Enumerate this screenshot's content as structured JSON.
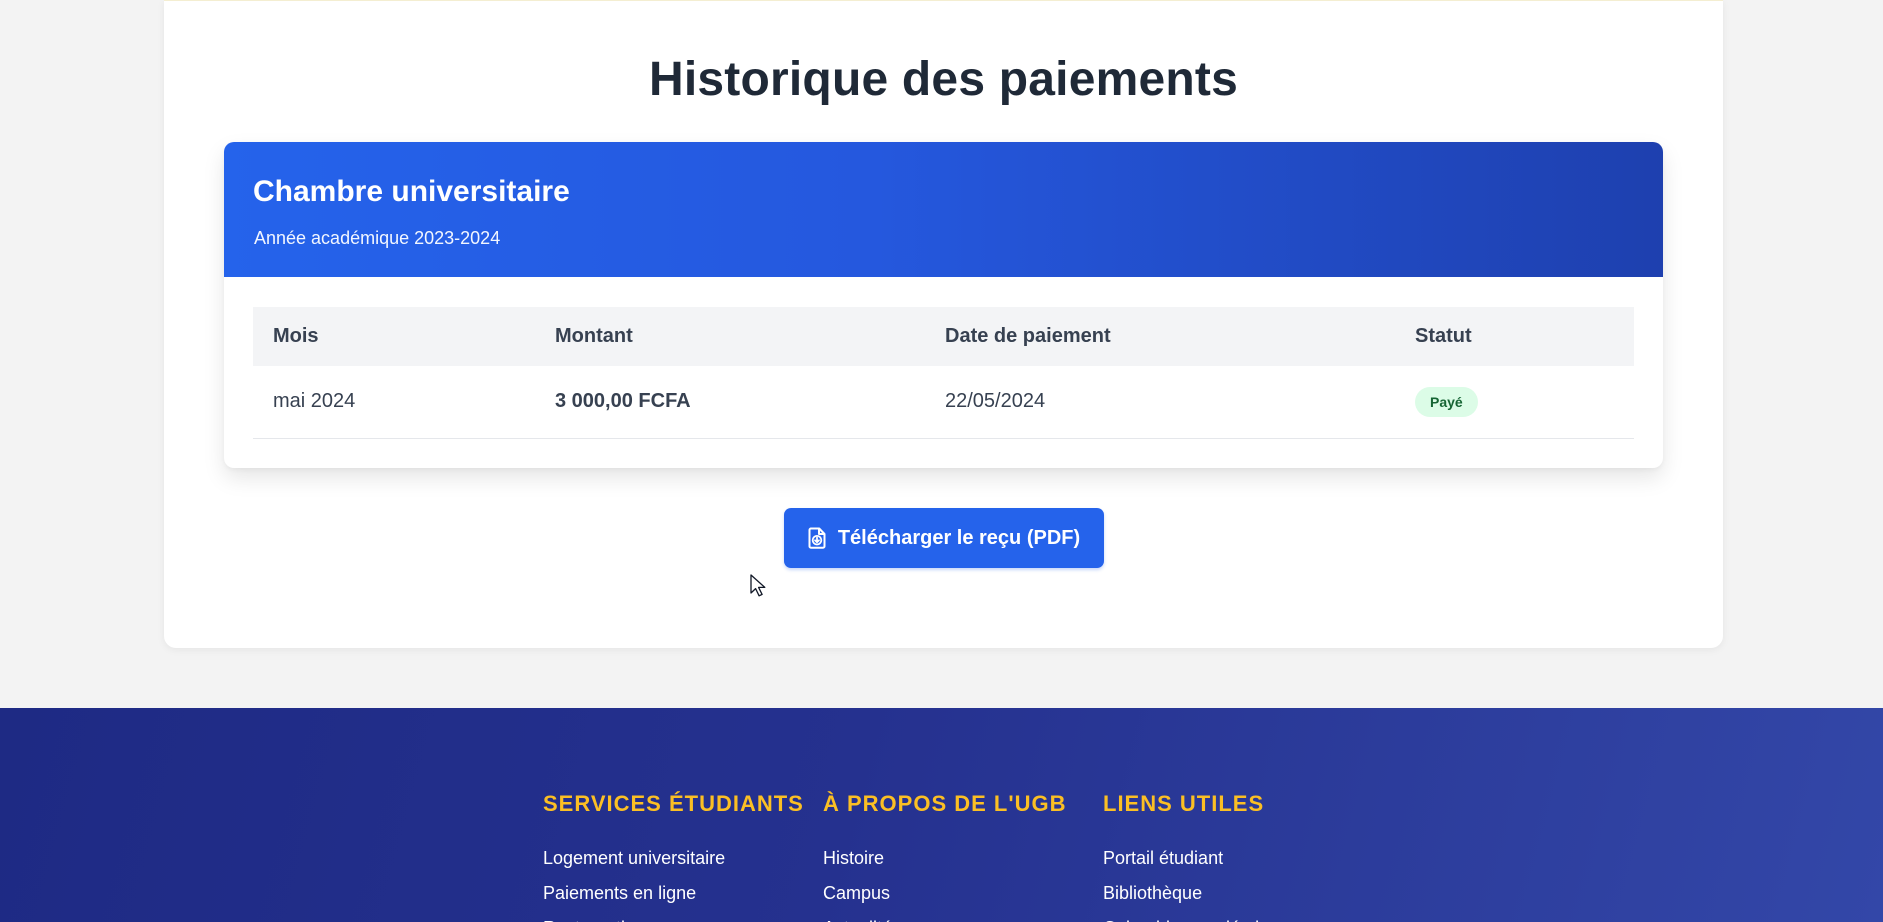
{
  "page": {
    "title": "Historique des paiements"
  },
  "payment_card": {
    "title": "Chambre universitaire",
    "subtitle": "Année académique 2023-2024",
    "table": {
      "headers": [
        "Mois",
        "Montant",
        "Date de paiement",
        "Statut"
      ],
      "rows": [
        {
          "month": "mai 2024",
          "amount": "3 000,00 FCFA",
          "payment_date": "22/05/2024",
          "status": "Payé"
        }
      ]
    }
  },
  "actions": {
    "download_receipt_label": "Télécharger le reçu (PDF)",
    "download_icon": "file-download-icon"
  },
  "footer": {
    "columns": [
      {
        "heading": "SERVICES ÉTUDIANTS",
        "links": [
          "Logement universitaire",
          "Paiements en ligne",
          "Restauration"
        ]
      },
      {
        "heading": "À PROPOS DE L'UGB",
        "links": [
          "Histoire",
          "Campus",
          "Actualités"
        ]
      },
      {
        "heading": "LIENS UTILES",
        "links": [
          "Portail étudiant",
          "Bibliothèque",
          "Calendrier académique"
        ]
      }
    ]
  },
  "colors": {
    "primary": "#2563eb",
    "footer_heading": "#fbbf24",
    "status_paid_bg": "#dcfce7",
    "status_paid_text": "#166534"
  }
}
